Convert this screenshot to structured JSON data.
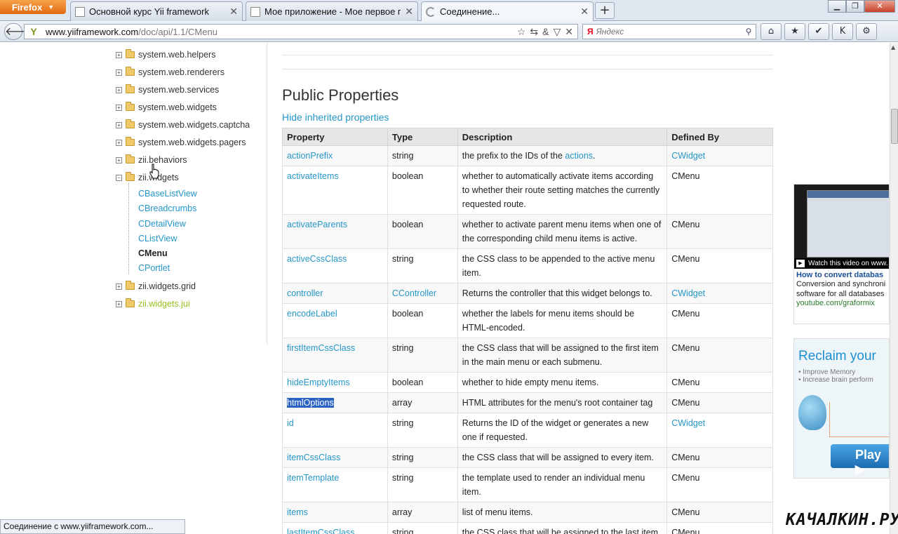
{
  "browser": {
    "menu_label": "Firefox",
    "tabs": [
      {
        "title": "Основной курс Yii framework",
        "loading": false
      },
      {
        "title": "Мое приложение - Мое первое при...",
        "loading": false
      },
      {
        "title": "Соединение...",
        "loading": true
      }
    ],
    "new_tab_label": "+",
    "url_host": "www.yiiframework.com",
    "url_path": "/doc/api/1.1/CMenu",
    "search_engine": "Я",
    "search_placeholder": "Яндекс",
    "status_text": "Соединение с www.yiiframework.com..."
  },
  "sidebar": {
    "items_top": [
      {
        "label": "system.web.helpers"
      },
      {
        "label": "system.web.renderers"
      },
      {
        "label": "system.web.services"
      },
      {
        "label": "system.web.widgets"
      },
      {
        "label": "system.web.widgets.captcha"
      },
      {
        "label": "system.web.widgets.pagers"
      },
      {
        "label": "zii.behaviors"
      },
      {
        "label": "zii.widgets"
      }
    ],
    "children": [
      {
        "label": "CBaseListView"
      },
      {
        "label": "CBreadcrumbs"
      },
      {
        "label": "CDetailView"
      },
      {
        "label": "CListView"
      },
      {
        "label": "CMenu"
      },
      {
        "label": "CPortlet"
      }
    ],
    "items_bottom": [
      {
        "label": "zii.widgets.grid"
      },
      {
        "label": "zii.widgets.jui"
      }
    ]
  },
  "main": {
    "section_title": "Public Properties",
    "toggle_link": "Hide inherited properties",
    "columns": [
      "Property",
      "Type",
      "Description",
      "Defined By"
    ],
    "rows": [
      {
        "property": "actionPrefix",
        "type": "string",
        "description": "the prefix to the IDs of the",
        "desc_link": "actions",
        "desc_after": ".",
        "defined_by": "CWidget"
      },
      {
        "property": "activateItems",
        "type": "boolean",
        "description": "whether to automatically activate items according to whether their route setting matches the currently requested route.",
        "defined_by": "CMenu"
      },
      {
        "property": "activateParents",
        "type": "boolean",
        "description": "whether to activate parent menu items when one of the corresponding child menu items is active.",
        "defined_by": "CMenu"
      },
      {
        "property": "activeCssClass",
        "type": "string",
        "description": "the CSS class to be appended to the active menu item.",
        "defined_by": "CMenu"
      },
      {
        "property": "controller",
        "type": "CController",
        "description": "Returns the controller that this widget belongs to.",
        "defined_by": "CWidget"
      },
      {
        "property": "encodeLabel",
        "type": "boolean",
        "description": "whether the labels for menu items should be HTML-encoded.",
        "defined_by": "CMenu"
      },
      {
        "property": "firstItemCssClass",
        "type": "string",
        "description": "the CSS class that will be assigned to the first item in the main menu or each submenu.",
        "defined_by": "CMenu"
      },
      {
        "property": "hideEmptyItems",
        "type": "boolean",
        "description": "whether to hide empty menu items.",
        "defined_by": "CMenu"
      },
      {
        "property": "htmlOptions",
        "type": "array",
        "description": "HTML attributes for the menu's root container tag",
        "defined_by": "CMenu"
      },
      {
        "property": "id",
        "type": "string",
        "description": "Returns the ID of the widget or generates a new one if requested.",
        "defined_by": "CWidget"
      },
      {
        "property": "itemCssClass",
        "type": "string",
        "description": "the CSS class that will be assigned to every item.",
        "defined_by": "CMenu"
      },
      {
        "property": "itemTemplate",
        "type": "string",
        "description": "the template used to render an individual menu item.",
        "defined_by": "CMenu"
      },
      {
        "property": "items",
        "type": "array",
        "description": "list of menu items.",
        "defined_by": "CMenu"
      },
      {
        "property": "lastItemCssClass",
        "type": "string",
        "description": "the CSS class that will be assigned to the last item in the main menu or each submenu.",
        "defined_by": "CMenu"
      }
    ]
  },
  "ads": {
    "video_caption": "Watch this video on www.",
    "video_title": "How to convert databas",
    "video_text_1": "Conversion and synchroni",
    "video_text_2": "software for all databases",
    "video_url": "youtube.com/graformix",
    "brain_title": "Reclaim your",
    "brain_bullet_1": "• Improve Memory",
    "brain_bullet_2": "• Increase brain perform",
    "brain_play": "Play ▶"
  },
  "watermark": "КАЧАЛКИН.РУ",
  "colors": {
    "link": "#2596c8",
    "highlight": "#96c01e",
    "selection": "#2a62c4"
  }
}
